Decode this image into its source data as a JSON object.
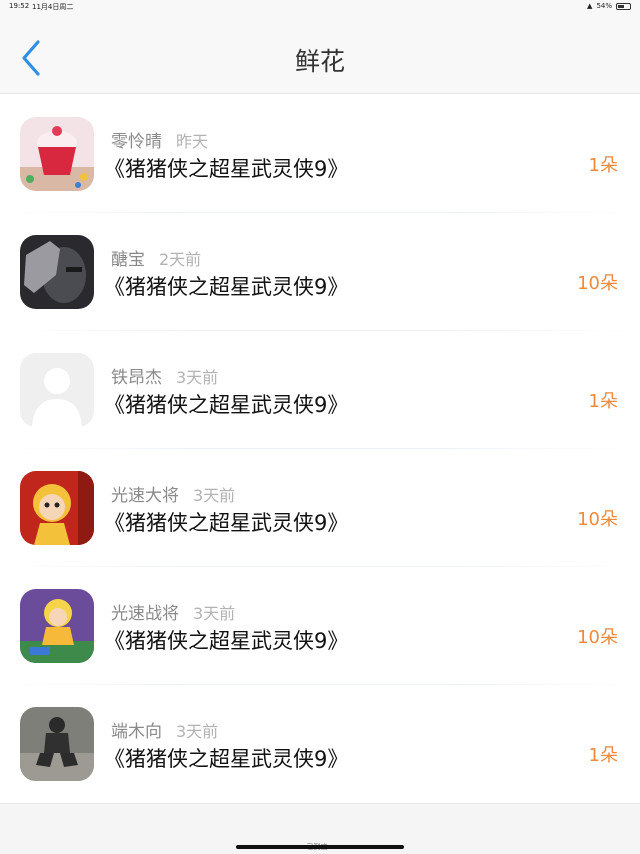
{
  "status_bar": {
    "time": "19:52",
    "date": "11月4日周二",
    "battery": "54%"
  },
  "nav": {
    "title": "鲜花"
  },
  "rows": [
    {
      "name": "零怜晴",
      "time": "昨天",
      "desc": "《猪猪侠之超星武灵侠9》",
      "count": "1朵",
      "avatar": "cupcake"
    },
    {
      "name": "醣宝",
      "time": "2天前",
      "desc": "《猪猪侠之超星武灵侠9》",
      "count": "10朵",
      "avatar": "hand-face"
    },
    {
      "name": "铁昂杰",
      "time": "3天前",
      "desc": "《猪猪侠之超星武灵侠9》",
      "count": "1朵",
      "avatar": "default-person"
    },
    {
      "name": "光速大将",
      "time": "3天前",
      "desc": "《猪猪侠之超星武灵侠9》",
      "count": "10朵",
      "avatar": "cartoon-red"
    },
    {
      "name": "光速战将",
      "time": "3天前",
      "desc": "《猪猪侠之超星武灵侠9》",
      "count": "10朵",
      "avatar": "cartoon-yellow"
    },
    {
      "name": "端木向",
      "time": "3天前",
      "desc": "《猪猪侠之超星武灵侠9》",
      "count": "1朵",
      "avatar": "photo-person"
    }
  ],
  "footer": {
    "text": "已到底~"
  },
  "colors": {
    "accent_orange": "#ee8a3d",
    "back_blue": "#2f8fe6"
  }
}
